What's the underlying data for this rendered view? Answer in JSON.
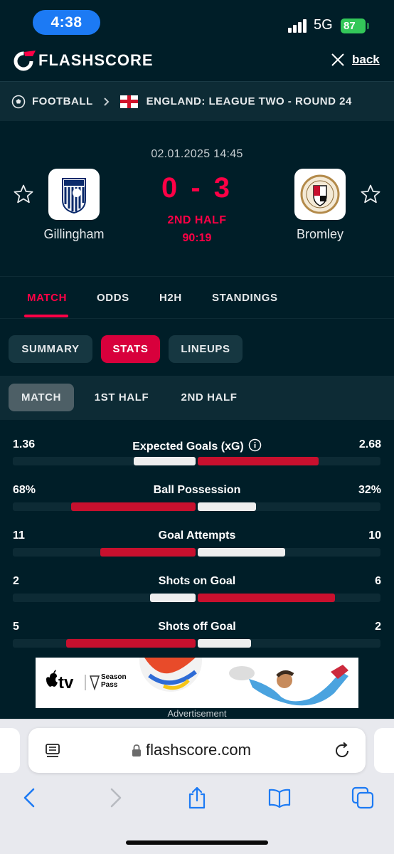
{
  "status_bar": {
    "time": "4:38",
    "network": "5G",
    "battery": "87"
  },
  "header": {
    "brand": "FLASHSCORE",
    "back_label": "back"
  },
  "breadcrumb": {
    "sport": "FOOTBALL",
    "competition": "ENGLAND: LEAGUE TWO - ROUND 24"
  },
  "match": {
    "datetime": "02.01.2025 14:45",
    "home_team": "Gillingham",
    "away_team": "Bromley",
    "score": "0 - 3",
    "status": "2ND HALF",
    "clock": "90:19"
  },
  "main_tabs": [
    "MATCH",
    "ODDS",
    "H2H",
    "STANDINGS"
  ],
  "sub_tabs": [
    "SUMMARY",
    "STATS",
    "LINEUPS"
  ],
  "period_tabs": [
    "MATCH",
    "1ST HALF",
    "2ND HALF"
  ],
  "stats": [
    {
      "label": "Expected Goals (xG)",
      "home": "1.36",
      "away": "2.68",
      "home_share": 0.34,
      "away_share": 0.66,
      "leader": "away",
      "info": true
    },
    {
      "label": "Ball Possession",
      "home": "68%",
      "away": "32%",
      "home_share": 0.68,
      "away_share": 0.32,
      "leader": "home"
    },
    {
      "label": "Goal Attempts",
      "home": "11",
      "away": "10",
      "home_share": 0.52,
      "away_share": 0.48,
      "leader": "home"
    },
    {
      "label": "Shots on Goal",
      "home": "2",
      "away": "6",
      "home_share": 0.25,
      "away_share": 0.75,
      "leader": "away"
    },
    {
      "label": "Shots off Goal",
      "home": "5",
      "away": "2",
      "home_share": 0.71,
      "away_share": 0.29,
      "leader": "home"
    }
  ],
  "ad": {
    "brand_text": "tv",
    "sub_text_1": "Season",
    "sub_text_2": "Pass",
    "caption": "Advertisement"
  },
  "browser": {
    "url": "flashscore.com"
  },
  "colors": {
    "accent": "#ff0046",
    "bar_leader": "#c8102e",
    "bar_other": "#eeeeee",
    "background": "#001e28"
  }
}
